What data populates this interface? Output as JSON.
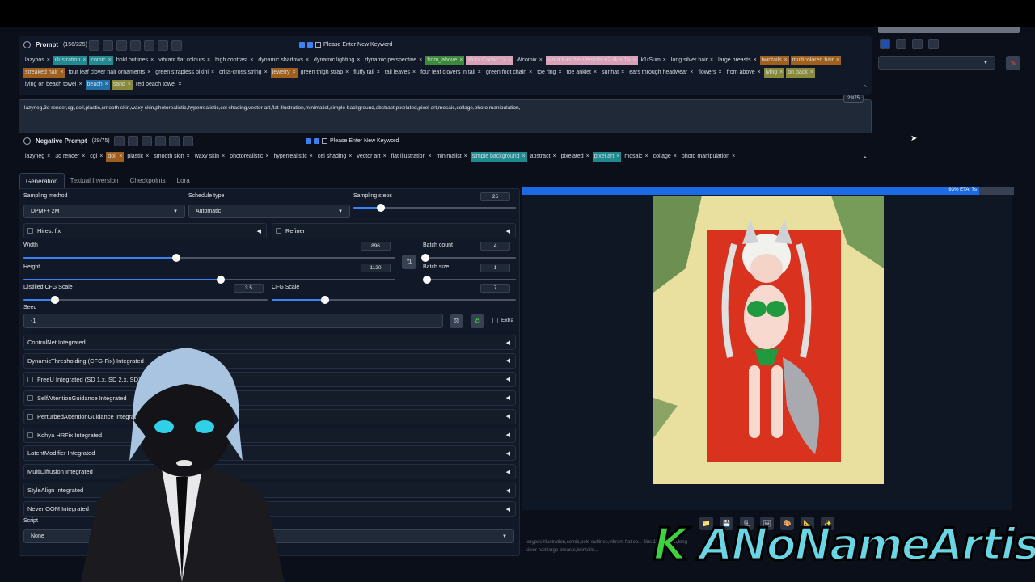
{
  "prompt": {
    "title": "Prompt",
    "count": "(156/225)",
    "keyword_placeholder": "Please Enter New Keyword",
    "tags": [
      {
        "text": "lazypos",
        "color": ""
      },
      {
        "text": "illustration",
        "color": "#1f8a8f"
      },
      {
        "text": "comic",
        "color": "#1f8a8f"
      },
      {
        "text": "bold outlines",
        "color": ""
      },
      {
        "text": "vibrant flat colours",
        "color": ""
      },
      {
        "text": "high contrast",
        "color": ""
      },
      {
        "text": "dynamic shadows",
        "color": ""
      },
      {
        "text": "dynamic lighting",
        "color": ""
      },
      {
        "text": "dynamic perspective",
        "color": ""
      },
      {
        "text": "from_above",
        "color": "#3a8a3a"
      },
      {
        "text": "<lora:Comic:1>",
        "color": "#d9a0b8"
      },
      {
        "text": "Wcomix",
        "color": ""
      },
      {
        "text": "<lora:Kirsche-Verstahl-v2-illus:1>",
        "color": "#d9a0b8"
      },
      {
        "text": "k1rSum",
        "color": ""
      },
      {
        "text": "long silver hair",
        "color": ""
      },
      {
        "text": "large breasts",
        "color": ""
      },
      {
        "text": "twintails",
        "color": "#a0601c"
      },
      {
        "text": "multicolored hair",
        "color": "#a0601c"
      },
      {
        "text": "streaked hair",
        "color": "#a0601c"
      },
      {
        "text": "four leaf clover hair ornaments",
        "color": ""
      },
      {
        "text": "green strapless bikini",
        "color": ""
      },
      {
        "text": "criss-cross string",
        "color": ""
      },
      {
        "text": "jewelry",
        "color": "#a0601c"
      },
      {
        "text": "green thigh strap",
        "color": ""
      },
      {
        "text": "fluffy tail",
        "color": ""
      },
      {
        "text": "tail leaves",
        "color": ""
      },
      {
        "text": "four leaf clovers in tail",
        "color": ""
      },
      {
        "text": "green foot chain",
        "color": ""
      },
      {
        "text": "toe ring",
        "color": ""
      },
      {
        "text": "toe anklet",
        "color": ""
      },
      {
        "text": "sunhat",
        "color": ""
      },
      {
        "text": "ears through headwear",
        "color": ""
      },
      {
        "text": "flowers",
        "color": ""
      },
      {
        "text": "from above",
        "color": ""
      },
      {
        "text": "lying",
        "color": "#8a8a3a"
      },
      {
        "text": "on back",
        "color": "#8a8a3a"
      },
      {
        "text": "lying on beach towel",
        "color": ""
      },
      {
        "text": "beach",
        "color": "#1f6fa8"
      },
      {
        "text": "sand",
        "color": "#8a8a3a"
      },
      {
        "text": "red beach towel",
        "color": ""
      }
    ],
    "neg_text": "lazyneg,3d render,cgi,doll,plastic,smooth skin,waxy skin,photorealistic,hyperrealistic,cel shading,vector art,flat illustration,minimalist,simple background,abstract,pixelated,pixel art,mosaic,collage,photo manipulation,",
    "neg_text_count": "29/75"
  },
  "negative": {
    "title": "Negative Prompt",
    "count": "(29/75)",
    "keyword_placeholder": "Please Enter New Keyword",
    "tags": [
      {
        "text": "lazyneg",
        "color": ""
      },
      {
        "text": "3d render",
        "color": ""
      },
      {
        "text": "cgi",
        "color": ""
      },
      {
        "text": "doll",
        "color": "#a0601c"
      },
      {
        "text": "plastic",
        "color": ""
      },
      {
        "text": "smooth skin",
        "color": ""
      },
      {
        "text": "waxy skin",
        "color": ""
      },
      {
        "text": "photorealistic",
        "color": ""
      },
      {
        "text": "hyperrealistic",
        "color": ""
      },
      {
        "text": "cel shading",
        "color": ""
      },
      {
        "text": "vector art",
        "color": ""
      },
      {
        "text": "flat illustration",
        "color": ""
      },
      {
        "text": "minimalist",
        "color": ""
      },
      {
        "text": "simple background",
        "color": "#1f8a8f"
      },
      {
        "text": "abstract",
        "color": ""
      },
      {
        "text": "pixelated",
        "color": ""
      },
      {
        "text": "pixel art",
        "color": "#1f8a8f"
      },
      {
        "text": "mosaic",
        "color": ""
      },
      {
        "text": "collage",
        "color": ""
      },
      {
        "text": "photo manipulation",
        "color": ""
      }
    ]
  },
  "tabs": [
    "Generation",
    "Textual Inversion",
    "Checkpoints",
    "Lora"
  ],
  "params": {
    "sampling_method_label": "Sampling method",
    "sampling_method": "DPM++ 2M",
    "schedule_type_label": "Schedule type",
    "schedule_type": "Automatic",
    "sampling_steps_label": "Sampling steps",
    "sampling_steps": "25",
    "sampling_steps_frac": 0.17,
    "hires_label": "Hires. fix",
    "refiner_label": "Refiner",
    "width_label": "Width",
    "width": "896",
    "width_frac": 0.41,
    "height_label": "Height",
    "height": "1120",
    "height_frac": 0.53,
    "batch_count_label": "Batch count",
    "batch_count": "4",
    "batch_count_frac": 0.03,
    "batch_size_label": "Batch size",
    "batch_size": "1",
    "batch_size_frac": 0.0,
    "distilled_cfg_label": "Distilled CFG Scale",
    "distilled_cfg": "3.5",
    "distilled_cfg_frac": 0.13,
    "cfg_label": "CFG Scale",
    "cfg": "7",
    "cfg_frac": 0.22,
    "seed_label": "Seed",
    "seed": "-1",
    "extra_label": "Extra",
    "script_label": "Script",
    "script": "None"
  },
  "accordions": [
    {
      "label": "ControlNet Integrated",
      "check": false
    },
    {
      "label": "DynamicThresholding (CFG-Fix) Integrated",
      "check": false
    },
    {
      "label": "FreeU Integrated (SD 1.x, SD 2.x, SDXL)",
      "check": true
    },
    {
      "label": "SelfAttentionGuidance Integrated",
      "check": true
    },
    {
      "label": "PerturbedAttentionGuidance Integrated",
      "check": true
    },
    {
      "label": "Kohya HRFix Integrated",
      "check": true
    },
    {
      "label": "LatentModifier Integrated",
      "check": false
    },
    {
      "label": "MultiDiffusion Integrated",
      "check": false
    },
    {
      "label": "StyleAlign Integrated",
      "check": false
    },
    {
      "label": "Never OOM Integrated",
      "check": false
    }
  ],
  "progress": {
    "text": "93% ETA: 7s",
    "fraction": 0.93
  },
  "info_text": "lazypos,illustration,comic,bold outlines,vibrant flat co... illus:1> k1rSum,long silver hair,large breasts,twintails...",
  "watermark": {
    "k": "K",
    "name": "ANoNameArtist"
  },
  "colors": {
    "accent": "#3b82f6",
    "bg": "#0b0f19",
    "panel": "#111827"
  }
}
